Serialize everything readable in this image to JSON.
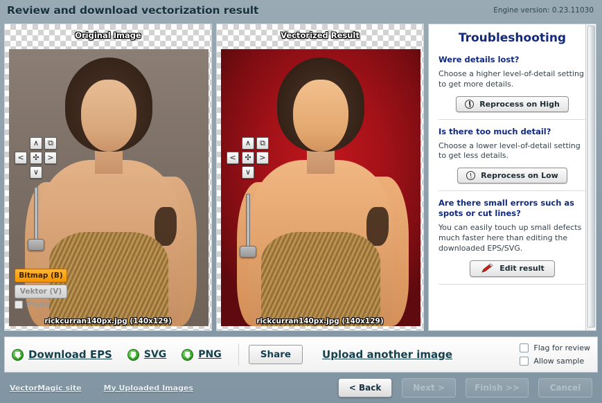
{
  "header": {
    "title": "Review and download vectorization result",
    "engine_version": "Engine version: 0.23.11030"
  },
  "panels": [
    {
      "caption": "Original Image",
      "filename": "rickcurran140px.jpg (140x129)",
      "controls": {
        "pan_up": "∧",
        "pan_left": "<",
        "pan_center": "✣",
        "pan_right": ">",
        "pan_down": "∨",
        "fit": "⧉"
      },
      "mode": {
        "bitmap": "Bitmap (B)",
        "vector": "Vektor (V)",
        "paths": "Pfade"
      }
    },
    {
      "caption": "Vectorized Result",
      "filename": "rickcurran140px.jpg (140x129)",
      "controls": {
        "pan_up": "∧",
        "pan_left": "<",
        "pan_center": "✣",
        "pan_right": ">",
        "pan_down": "∨",
        "fit": "⧉"
      }
    }
  ],
  "troubleshooting": {
    "title": "Troubleshooting",
    "sections": [
      {
        "question": "Were details lost?",
        "answer": "Choose a higher level-of-detail setting to get more details.",
        "button": "Reprocess on High",
        "icon": "clock-icon"
      },
      {
        "question": "Is there too much detail?",
        "answer": "Choose a lower level-of-detail setting to get less details.",
        "button": "Reprocess on Low",
        "icon": "clock-icon"
      },
      {
        "question": "Are there small errors such as spots or cut lines?",
        "answer": "You can easily touch up small defects much faster here than editing the downloaded EPS/SVG.",
        "button": "Edit result",
        "icon": "pencil-icon"
      }
    ]
  },
  "actionbar": {
    "downloads": [
      {
        "label": "Download EPS",
        "icon": "download-arrow-icon"
      },
      {
        "label": "SVG",
        "icon": "download-arrow-icon"
      },
      {
        "label": "PNG",
        "icon": "download-arrow-icon"
      }
    ],
    "share": "Share",
    "upload_another": "Upload another image",
    "checkboxes": [
      {
        "label": "Flag for review",
        "checked": false
      },
      {
        "label": "Allow sample",
        "checked": false
      }
    ]
  },
  "footer": {
    "links": [
      "VectorMagic site",
      "My Uploaded Images"
    ],
    "buttons": [
      {
        "label": "< Back",
        "enabled": true
      },
      {
        "label": "Next >",
        "enabled": false
      },
      {
        "label": "Finish >>",
        "enabled": false
      },
      {
        "label": "Cancel",
        "enabled": false
      }
    ]
  },
  "colors": {
    "app_background": "#8fa0ac",
    "title_text": "#17323f",
    "heading_blue": "#122a7c",
    "link_teal": "#15414f",
    "accent_orange": "#f59300",
    "download_green": "#2f9d23"
  }
}
